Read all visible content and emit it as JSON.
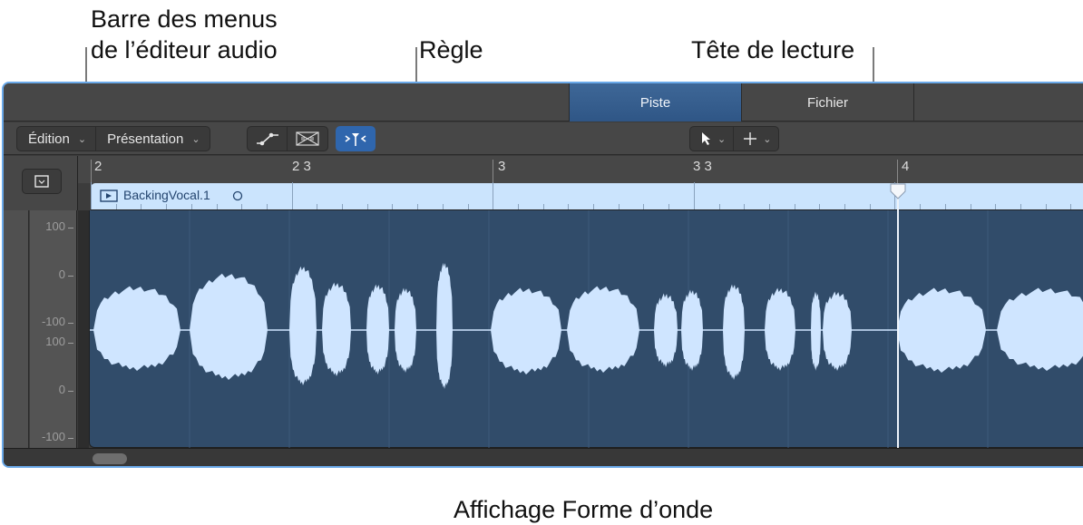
{
  "callouts": {
    "menu_bar_line1": "Barre des menus",
    "menu_bar_line2": "de l’éditeur audio",
    "ruler": "Règle",
    "playhead": "Tête de lecture",
    "waveform": "Affichage Forme d’onde"
  },
  "tabs": [
    {
      "label": "Piste",
      "active": true
    },
    {
      "label": "Fichier",
      "active": false
    }
  ],
  "toolbar": {
    "edit_menu": "Édition",
    "view_menu": "Présentation",
    "automation_icon": "automation-curve-icon",
    "flex_icon": "flex-waveform-icon",
    "catch_icon": "catch-playhead-icon",
    "left_tool_icon": "pointer-tool-icon",
    "right_tool_icon": "crosshair-tool-icon"
  },
  "ruler": {
    "marks": [
      "2",
      "2 3",
      "3",
      "3 3",
      "4"
    ]
  },
  "region": {
    "name": "BackingVocal.1",
    "color": "#cbe4fd"
  },
  "amplitude_scale": {
    "top_channel": [
      "100",
      "0",
      "-100"
    ],
    "bottom_channel": [
      "100",
      "0",
      "-100"
    ]
  },
  "colors": {
    "accent": "#2f66ad",
    "waveform": "#cfe5ff",
    "waveform_background": "#314c6a",
    "window_border": "#6aa9e9"
  }
}
